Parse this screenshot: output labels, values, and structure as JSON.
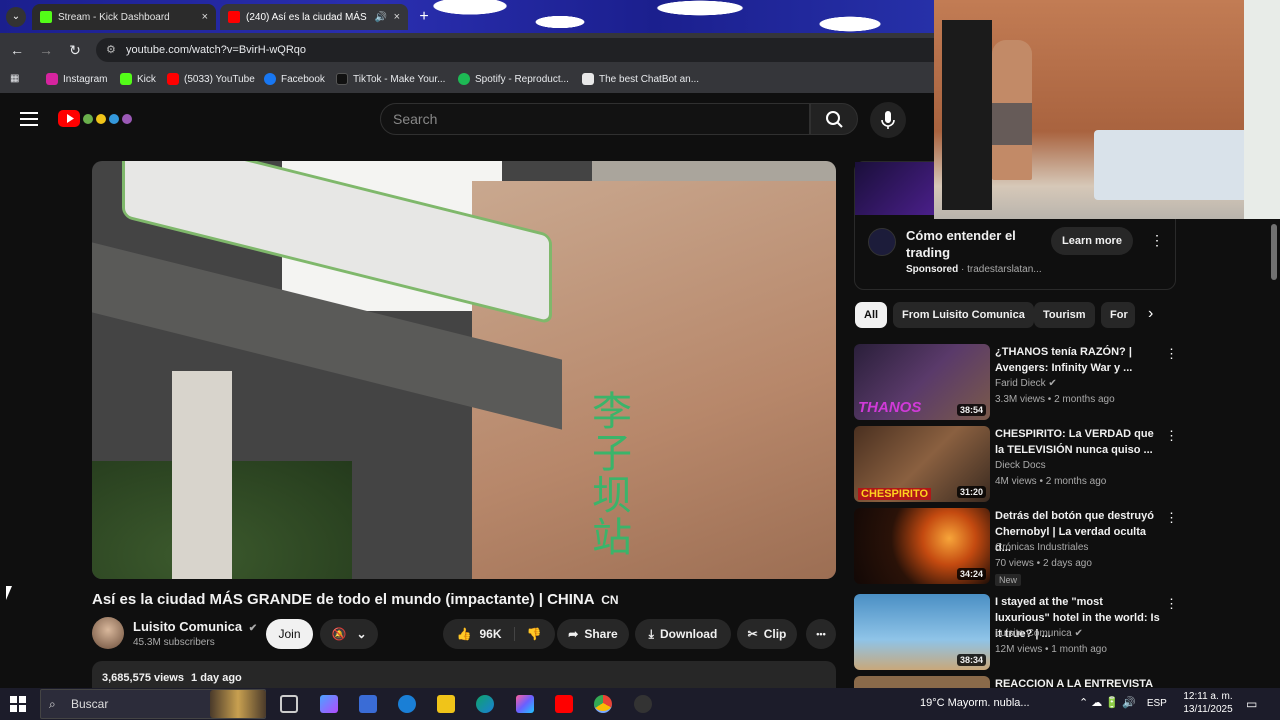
{
  "browser": {
    "tabs": [
      {
        "label": "Stream - Kick Dashboard",
        "close": "×",
        "favicon_color": "#53fc18"
      },
      {
        "label": "(240) Así es la ciudad MÁS",
        "close": "×",
        "favicon_color": "#ff0000"
      }
    ],
    "new_tab": "+",
    "tab_menu": "⌄",
    "url": "youtube.com/watch?v=BvirH-wQRqo",
    "bookmarks": [
      {
        "label": "Instagram",
        "color": "#d6249f"
      },
      {
        "label": "Kick",
        "color": "#53fc18"
      },
      {
        "label": "(5033) YouTube",
        "color": "#ff0000"
      },
      {
        "label": "Facebook",
        "color": "#1877f2"
      },
      {
        "label": "TikTok - Make Your...",
        "color": "#111111"
      },
      {
        "label": "Spotify - Reproduct...",
        "color": "#1db954"
      },
      {
        "label": "The best ChatBot an...",
        "color": "#e8e8e8"
      }
    ]
  },
  "youtube": {
    "search_placeholder": "Search",
    "video": {
      "title": "Así es la ciudad MÁS GRANDE de todo el mundo (impactante) | CHINA",
      "title_flag": "CN",
      "channel": "Luisito Comunica",
      "verified": "✔",
      "subscribers": "45.3M subscribers",
      "join": "Join",
      "likes": "96K",
      "share": "Share",
      "download": "Download",
      "clip": "Clip",
      "more": "•••",
      "views": "3,685,575 views",
      "date": "1 day ago",
      "sign_text": "李子坝站"
    },
    "ad": {
      "title": "Cómo entender el trading",
      "sponsored": "Sponsored",
      "sponsor_sep": " · ",
      "sponsor_name": "tradestarslatan...",
      "learn_more": "Learn more",
      "menu": "⋮"
    },
    "chips": [
      "All",
      "From Luisito Comunica",
      "Tourism",
      "For"
    ],
    "chips_next": "›",
    "recommendations": [
      {
        "title": "¿THANOS tenía RAZÓN? | Avengers: Infinity War y ...",
        "channel": "Farid Dieck",
        "verified": true,
        "meta": "3.3M views • 2 months ago",
        "duration": "38:54",
        "badge": "",
        "thumb_text": "THANOS",
        "thumb_color": "#3a2a4a",
        "menu": "⋮"
      },
      {
        "title": "CHESPIRITO: La VERDAD que la TELEVISIÓN nunca quiso ...",
        "channel": "Dieck Docs",
        "verified": false,
        "meta": "4M views • 2 months ago",
        "duration": "31:20",
        "badge": "",
        "thumb_text": "CHESPIRITO",
        "thumb_color": "#6a4a2a",
        "menu": "⋮"
      },
      {
        "title": "Detrás del botón que destruyó Chernobyl | La verdad oculta d...",
        "channel": "Crónicas Industriales",
        "verified": false,
        "meta": "70 views • 2 days ago",
        "duration": "34:24",
        "badge": "New",
        "thumb_text": "",
        "thumb_color": "#2a1a10",
        "menu": "⋮"
      },
      {
        "title": "I stayed at the \"most luxurious\" hotel in the world: Is it true? | ...",
        "channel": "Luisito Comunica",
        "verified": true,
        "meta": "12M views • 1 month ago",
        "duration": "38:34",
        "badge": "",
        "thumb_text": "",
        "thumb_color": "#4a8fc4",
        "menu": "⋮"
      },
      {
        "title": "REACCION A LA ENTREVISTA",
        "channel": "",
        "verified": false,
        "meta": "",
        "duration": "",
        "badge": "",
        "thumb_text": "",
        "thumb_color": "#8a6a4a",
        "menu": ""
      }
    ]
  },
  "taskbar": {
    "search": "Buscar",
    "weather": "19°C  Mayorm. nubla...",
    "lang": "ESP",
    "time": "12:11 a. m.",
    "date": "13/11/2025",
    "tray_icons": "⌃  ☁  🔋  🔊"
  }
}
